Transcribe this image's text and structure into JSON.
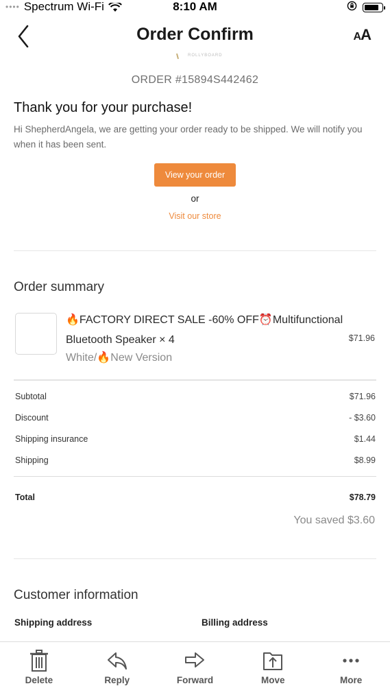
{
  "status_bar": {
    "signal": "••••",
    "carrier": "Spectrum Wi-Fi",
    "time": "8:10 AM"
  },
  "nav": {
    "title": "Order Confirm",
    "text_size_large": "A",
    "text_size_small": "A"
  },
  "logo": {
    "text": "ROLLYBOARD"
  },
  "order": {
    "number": "ORDER #15894S442462",
    "thanks": "Thank you for your purchase!",
    "intro": "Hi ShepherdAngela, we are getting your order ready to be shipped. We will notify you when it has been sent.",
    "view_order_label": "View your order",
    "or_text": "or",
    "visit_store_label": "Visit our store"
  },
  "summary": {
    "title": "Order summary",
    "item": {
      "name": "🔥FACTORY DIRECT SALE -60% OFF⏰Multifunctional Bluetooth Speaker × 4",
      "variant": "White/🔥New Version",
      "price": "$71.96"
    },
    "rows": [
      {
        "label": "Subtotal",
        "value": "$71.96"
      },
      {
        "label": "Discount",
        "value": "- $3.60"
      },
      {
        "label": "Shipping insurance",
        "value": "$1.44"
      },
      {
        "label": "Shipping",
        "value": "$8.99"
      }
    ],
    "total_label": "Total",
    "total_value": "$78.79",
    "saved": "You saved $3.60"
  },
  "customer": {
    "title": "Customer information",
    "shipping_label": "Shipping address",
    "billing_label": "Billing address"
  },
  "toolbar": {
    "delete": "Delete",
    "reply": "Reply",
    "forward": "Forward",
    "move": "Move",
    "more": "More"
  },
  "colors": {
    "accent": "#ee8a3c",
    "muted_text": "#6b6b6b",
    "divider": "#e6e6e6"
  },
  "icons": [
    "wifi-icon",
    "lock-rotation-icon",
    "battery-icon",
    "chevron-left-icon",
    "trash-icon",
    "reply-icon",
    "forward-icon",
    "move-folder-icon",
    "more-dots-icon"
  ]
}
